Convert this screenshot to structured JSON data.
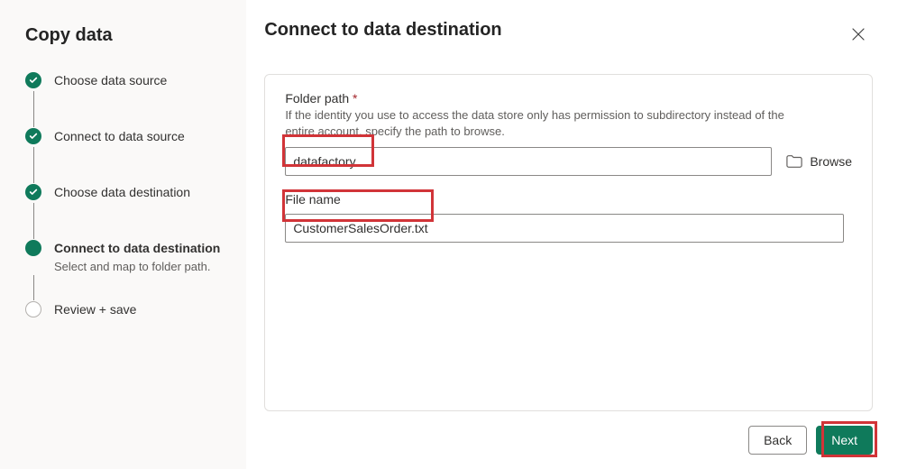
{
  "sidebar": {
    "title": "Copy data",
    "steps": [
      {
        "label": "Choose data source",
        "state": "done"
      },
      {
        "label": "Connect to data source",
        "state": "done"
      },
      {
        "label": "Choose data destination",
        "state": "done"
      },
      {
        "label": "Connect to data destination",
        "state": "current",
        "sub": "Select and map to folder path."
      },
      {
        "label": "Review + save",
        "state": "pending"
      }
    ]
  },
  "panel": {
    "title": "Connect to data destination",
    "folder": {
      "label": "Folder path",
      "required": true,
      "help": "If the identity you use to access the data store only has permission to subdirectory instead of the entire account, specify the path to browse.",
      "value": "datafactory",
      "browse_label": "Browse"
    },
    "file": {
      "label": "File name",
      "value": "CustomerSalesOrder.txt"
    }
  },
  "footer": {
    "back_label": "Back",
    "next_label": "Next"
  },
  "colors": {
    "accent": "#0f7a5b",
    "highlight": "#d13438"
  }
}
